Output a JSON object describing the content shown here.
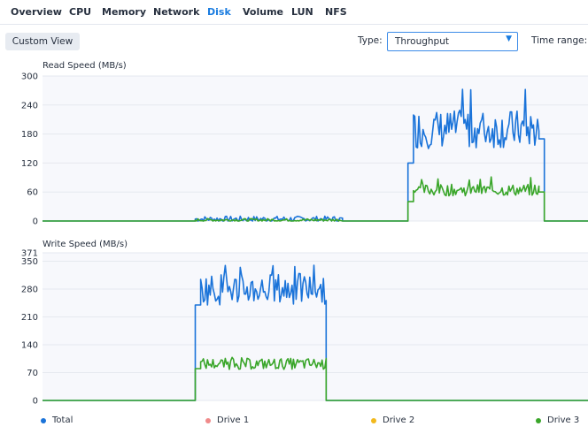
{
  "tabs": [
    {
      "label": "Overview",
      "active": false
    },
    {
      "label": "CPU",
      "active": false
    },
    {
      "label": "Memory",
      "active": false
    },
    {
      "label": "Network",
      "active": false
    },
    {
      "label": "Disk",
      "active": true
    },
    {
      "label": "Volume",
      "active": false
    },
    {
      "label": "LUN",
      "active": false
    },
    {
      "label": "NFS",
      "active": false
    }
  ],
  "toolbar": {
    "custom_view_label": "Custom View",
    "type_label": "Type:",
    "type_value": "Throughput",
    "time_range_label": "Time range:"
  },
  "colors": {
    "total": "#1a73d9",
    "drive1": "#f08a8a",
    "drive2": "#f2b91c",
    "drive3": "#3aa62a",
    "grid": "#e6e9ef",
    "plot_bg": "#f7f8fc"
  },
  "legend": [
    {
      "label": "Total",
      "color": "#1a73d9"
    },
    {
      "label": "Drive 1",
      "color": "#f08a8a"
    },
    {
      "label": "Drive 2",
      "color": "#f2b91c"
    },
    {
      "label": "Drive 3",
      "color": "#3aa62a"
    }
  ],
  "chart_data": [
    {
      "type": "line",
      "title": "Read Speed (MB/s)",
      "ylim": [
        0,
        300
      ],
      "yticks": [
        "0",
        "60",
        "120",
        "180",
        "240",
        "300"
      ],
      "ytick_values": [
        0,
        60,
        120,
        180,
        240,
        300
      ],
      "x_unit": "sample index (0-100, no labels shown)",
      "grid": true,
      "series": [
        {
          "name": "Total",
          "color": "#1a73d9",
          "segments": [
            {
              "from": 0,
              "to": 28,
              "level": 0
            },
            {
              "from": 28,
              "to": 55,
              "level": 4,
              "noise": 6
            },
            {
              "from": 55,
              "to": 67,
              "level": 0
            },
            {
              "from": 67,
              "to": 68,
              "level": 120
            },
            {
              "from": 68,
              "to": 91,
              "level": 190,
              "noise": 40,
              "peak": 277
            },
            {
              "from": 91,
              "to": 92,
              "level": 170
            },
            {
              "from": 92,
              "to": 100,
              "level": 0
            }
          ]
        },
        {
          "name": "Drive 3",
          "color": "#3aa62a",
          "segments": [
            {
              "from": 0,
              "to": 28,
              "level": 0
            },
            {
              "from": 28,
              "to": 55,
              "level": 2,
              "noise": 3
            },
            {
              "from": 55,
              "to": 67,
              "level": 0
            },
            {
              "from": 67,
              "to": 68,
              "level": 40
            },
            {
              "from": 68,
              "to": 91,
              "level": 64,
              "noise": 12,
              "peak": 92
            },
            {
              "from": 91,
              "to": 92,
              "level": 60
            },
            {
              "from": 92,
              "to": 100,
              "level": 0
            }
          ]
        }
      ]
    },
    {
      "type": "line",
      "title": "Write Speed (MB/s)",
      "ylim": [
        0,
        371
      ],
      "yticks": [
        "0",
        "70",
        "140",
        "210",
        "280",
        "350",
        "371"
      ],
      "ytick_values": [
        0,
        70,
        140,
        210,
        280,
        350,
        371
      ],
      "x_unit": "sample index (0-100, no labels shown)",
      "grid": true,
      "series": [
        {
          "name": "Total",
          "color": "#1a73d9",
          "segments": [
            {
              "from": 0,
              "to": 28,
              "level": 0
            },
            {
              "from": 28,
              "to": 29,
              "level": 240
            },
            {
              "from": 29,
              "to": 52,
              "level": 280,
              "noise": 40,
              "peak": 340
            },
            {
              "from": 52,
              "to": 53,
              "level": 0
            },
            {
              "from": 53,
              "to": 100,
              "level": 0
            }
          ]
        },
        {
          "name": "Drive 3",
          "color": "#3aa62a",
          "segments": [
            {
              "from": 0,
              "to": 28,
              "level": 0
            },
            {
              "from": 28,
              "to": 29,
              "level": 80
            },
            {
              "from": 29,
              "to": 52,
              "level": 92,
              "noise": 14,
              "peak": 110
            },
            {
              "from": 52,
              "to": 53,
              "level": 0
            },
            {
              "from": 53,
              "to": 100,
              "level": 0
            }
          ]
        }
      ]
    }
  ]
}
